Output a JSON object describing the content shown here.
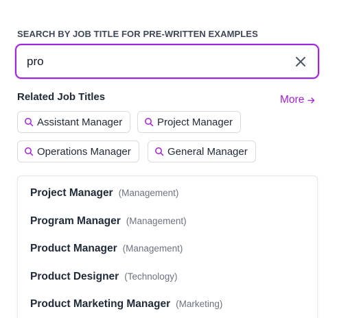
{
  "search": {
    "label": "SEARCH BY JOB TITLE FOR PRE-WRITTEN EXAMPLES",
    "value": "pro"
  },
  "related": {
    "title": "Related Job Titles",
    "more_label": "More",
    "chips": [
      {
        "label": "Assistant Manager"
      },
      {
        "label": "Project Manager"
      },
      {
        "label": "Operations Manager"
      },
      {
        "label": "General Manager"
      }
    ]
  },
  "suggestions": [
    {
      "title": "Project Manager",
      "category": "(Management)"
    },
    {
      "title": "Program Manager",
      "category": "(Management)"
    },
    {
      "title": "Product Manager",
      "category": "(Management)"
    },
    {
      "title": "Product Designer",
      "category": "(Technology)"
    },
    {
      "title": "Product Marketing Manager",
      "category": "(Marketing)"
    }
  ],
  "colors": {
    "accent": "#a21fd6",
    "focus_border": "#9d27d6"
  }
}
